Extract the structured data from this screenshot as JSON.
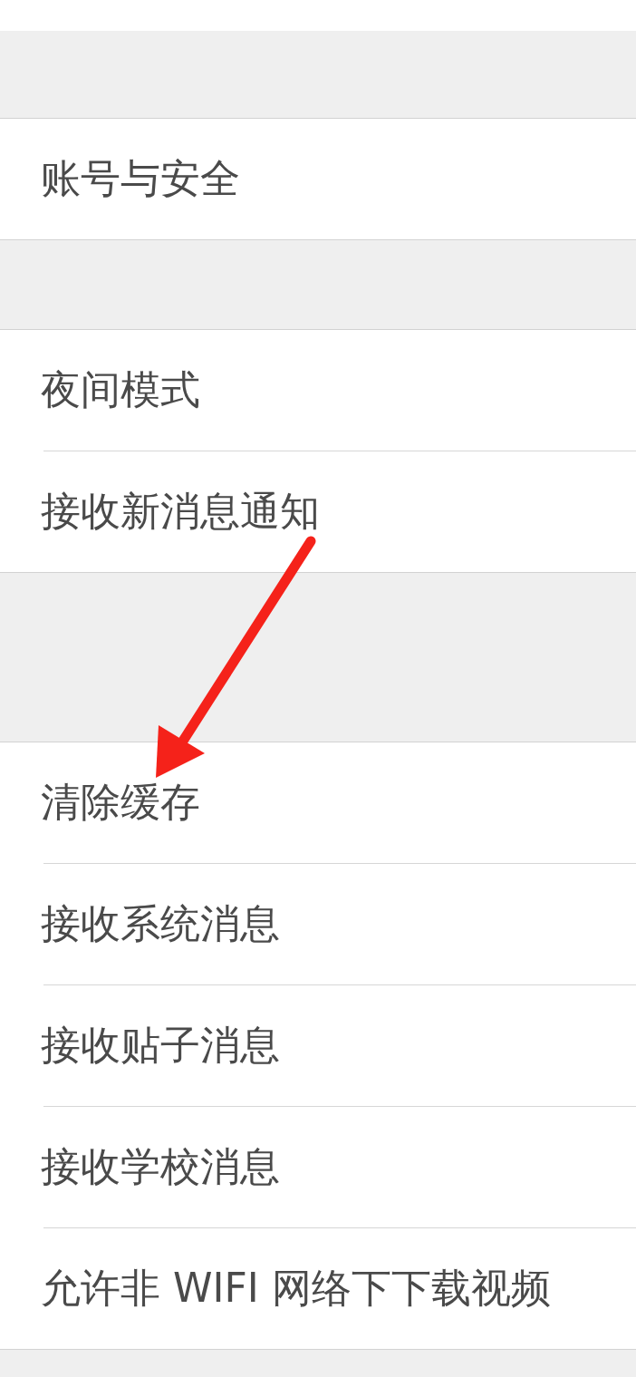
{
  "sections": [
    {
      "items": [
        {
          "label": "账号与安全"
        }
      ]
    },
    {
      "items": [
        {
          "label": "夜间模式"
        },
        {
          "label": "接收新消息通知"
        }
      ]
    },
    {
      "items": [
        {
          "label": "清除缓存"
        },
        {
          "label": "接收系统消息"
        },
        {
          "label": "接收贴子消息"
        },
        {
          "label": "接收学校消息"
        },
        {
          "label": "允许非 WIFI 网络下下载视频"
        }
      ]
    }
  ],
  "annotations": [
    {
      "kind": "arrow"
    }
  ]
}
